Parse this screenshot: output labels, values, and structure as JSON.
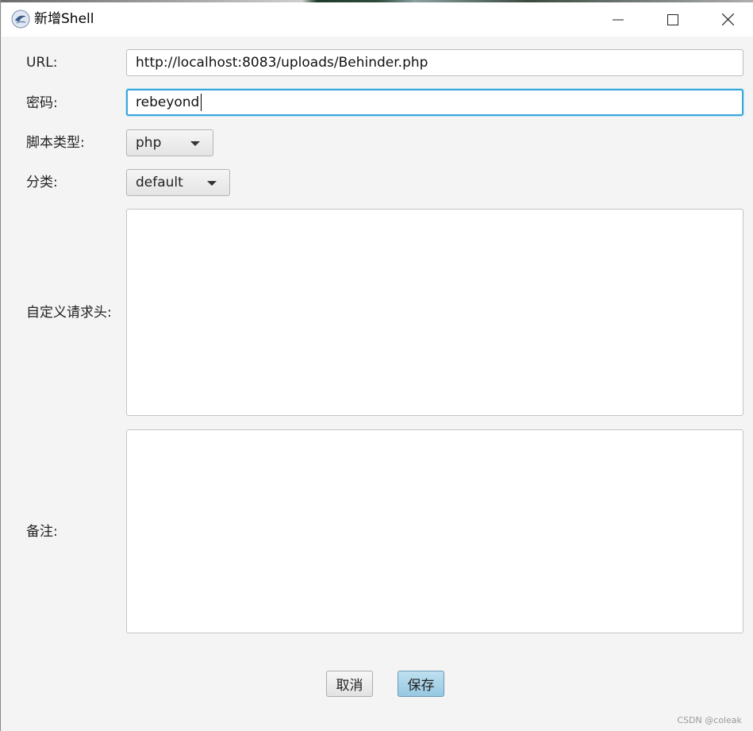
{
  "window": {
    "title": "新增Shell",
    "icon": "behinder-app-icon",
    "controls": {
      "minimize": "minimize-icon",
      "maximize": "maximize-icon",
      "close": "close-icon"
    }
  },
  "form": {
    "url_label": "URL:",
    "url_value": "http://localhost:8083/uploads/Behinder.php",
    "password_label": "密码:",
    "password_value": "rebeyond",
    "script_type_label": "脚本类型:",
    "script_type_value": "php",
    "category_label": "分类:",
    "category_value": "default",
    "headers_label": "自定义请求头:",
    "headers_value": "",
    "notes_label": "备注:",
    "notes_value": ""
  },
  "buttons": {
    "cancel_label": "取消",
    "save_label": "保存"
  },
  "watermark": "CSDN @coleak",
  "colors": {
    "focus_border": "#3aa6dc",
    "save_button": "#a6d2e8",
    "background": "#f4f4f4"
  }
}
